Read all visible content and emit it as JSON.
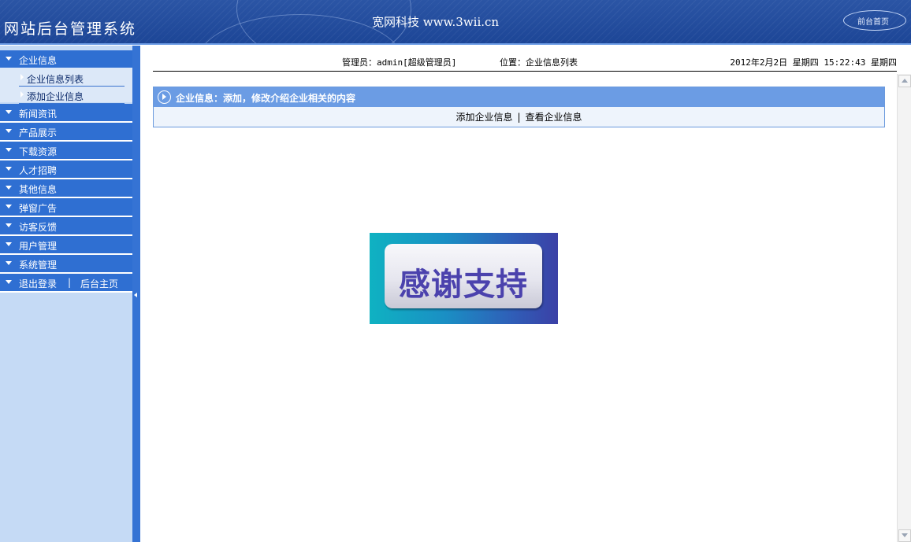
{
  "header": {
    "system_title": "网站后台管理系统",
    "company": "宽网科技  www.3wii.cn",
    "front_home_label": "前台首页"
  },
  "sidebar": {
    "menu": [
      {
        "label": "企业信息",
        "expanded": true
      },
      {
        "label": "新闻资讯"
      },
      {
        "label": "产品展示"
      },
      {
        "label": "下载资源"
      },
      {
        "label": "人才招聘"
      },
      {
        "label": "其他信息"
      },
      {
        "label": "弹窗广告"
      },
      {
        "label": "访客反馈"
      },
      {
        "label": "用户管理"
      },
      {
        "label": "系统管理"
      }
    ],
    "submenu": [
      {
        "label": "企业信息列表"
      },
      {
        "label": "添加企业信息"
      }
    ],
    "logout": {
      "logout_label": "退出登录",
      "separator": "|",
      "home_label": "后台主页"
    }
  },
  "infobar": {
    "admin": "管理员：admin[超级管理员]",
    "position": "位置：企业信息列表",
    "datetime": "2012年2月2日 星期四 15:22:43 星期四"
  },
  "panel": {
    "title": "企业信息：添加，修改介绍企业相关的内容",
    "add_link": "添加企业信息",
    "separator": "|",
    "view_link": "查看企业信息"
  },
  "banner": {
    "text": "感谢支持"
  },
  "colors": {
    "header_bg": "#1c4596",
    "menu_bg": "#2f6fd2",
    "sidebar_bg": "#c5daf5",
    "panel_head": "#6b9ce4"
  }
}
